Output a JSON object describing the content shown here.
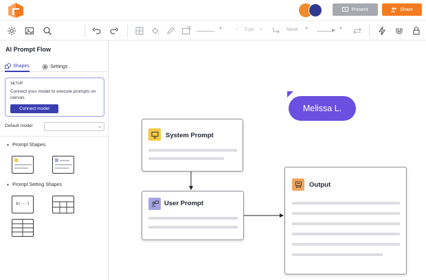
{
  "header": {
    "logo": "lucid-logo-icon",
    "present_label": "Present",
    "share_label": "Share",
    "colors": {
      "present": "#a7a9b0",
      "share": "#f47a20",
      "accent": "#3a3fb0",
      "collaborator": "#6a4fe0"
    }
  },
  "toolbar": {
    "line_width": "2 px",
    "endpoint": "None"
  },
  "panel": {
    "title": "AI Prompt Flow",
    "tabs": [
      {
        "label": "Shapes"
      },
      {
        "label": "Settings"
      }
    ],
    "setup": {
      "label": "SETUP",
      "text": "Connect your model to execute prompts on canvas",
      "button": "Connect model"
    },
    "default_model_label": "Default model",
    "default_model_value": "",
    "sections": [
      {
        "label": "Prompt Shapes"
      },
      {
        "label": "Prompt Setting Shapes"
      }
    ],
    "variable_tile_text": "${---}"
  },
  "canvas": {
    "collaborator": "Melissa L.",
    "cards": {
      "system": {
        "title": "System Prompt",
        "icon": "monitor-icon"
      },
      "user": {
        "title": "User Prompt",
        "icon": "user-chat-icon"
      },
      "output": {
        "title": "Output",
        "icon": "output-icon"
      }
    }
  }
}
